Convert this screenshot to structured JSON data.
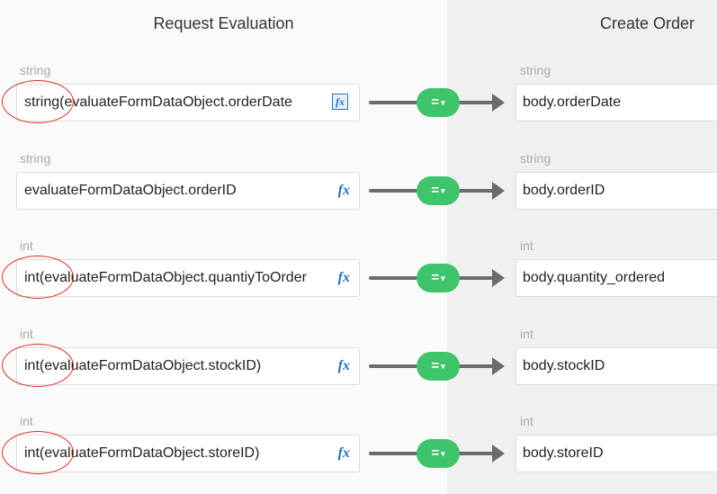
{
  "headers": {
    "left": "Request Evaluation",
    "right": "Create Order"
  },
  "operator": {
    "label": "=",
    "caret": "▾"
  },
  "annotation_color": "#d9302a",
  "rows": [
    {
      "src_type": "string",
      "src_value": "string(evaluateFormDataObject.orderDate",
      "fx": "fx",
      "dst_type": "string",
      "dst_value": "body.orderDate"
    },
    {
      "src_type": "string",
      "src_value": "evaluateFormDataObject.orderID",
      "fx": "fx",
      "dst_type": "string",
      "dst_value": "body.orderID"
    },
    {
      "src_type": "int",
      "src_value": "int(evaluateFormDataObject.quantiyToOrder",
      "fx": "fx",
      "dst_type": "int",
      "dst_value": "body.quantity_ordered"
    },
    {
      "src_type": "int",
      "src_value": "int(evaluateFormDataObject.stockID)",
      "fx": "fx",
      "dst_type": "int",
      "dst_value": "body.stockID"
    },
    {
      "src_type": "int",
      "src_value": "int(evaluateFormDataObject.storeID)",
      "fx": "fx",
      "dst_type": "int",
      "dst_value": "body.storeID"
    }
  ]
}
